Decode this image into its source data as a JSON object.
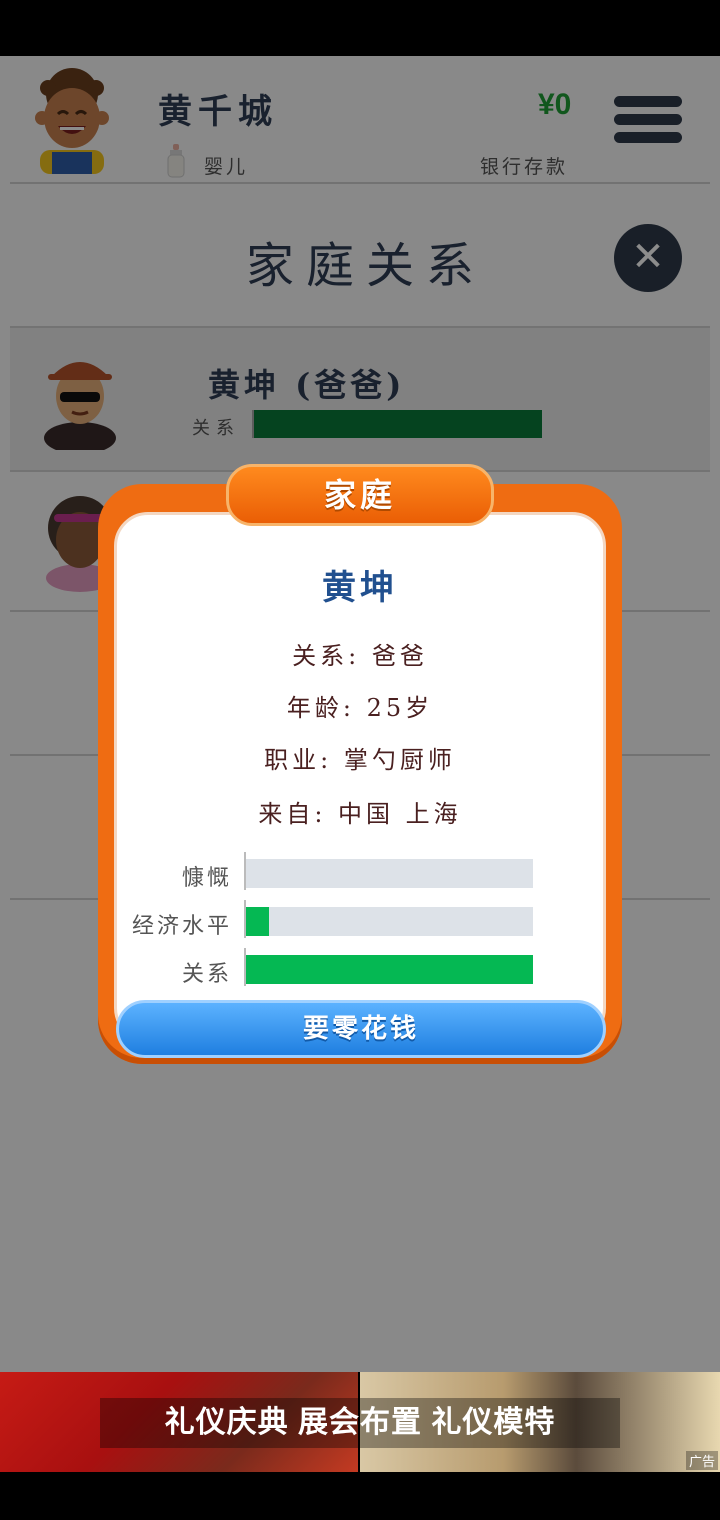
{
  "header": {
    "player_name": "黄千城",
    "life_stage": "婴儿",
    "money": "¥0",
    "money_label": "银行存款"
  },
  "page": {
    "title": "家庭关系"
  },
  "relatives": [
    {
      "name": "黄坤 (爸爸)",
      "relation_label": "关系",
      "relation_level": 1.0
    }
  ],
  "modal": {
    "tab_title": "家庭",
    "person_name": "黄坤",
    "relation_line": "关系: 爸爸",
    "age_line": "年龄: 25岁",
    "job_line": "职业: 掌勺厨师",
    "origin_line": "来自: 中国 上海",
    "stats": [
      {
        "label": "慷慨",
        "level": 0.0
      },
      {
        "label": "经济水平",
        "level": 0.08
      },
      {
        "label": "关系",
        "level": 1.0
      }
    ],
    "action_button": "要零花钱"
  },
  "ad": {
    "text": "礼仪庆典  展会布置  礼仪模特",
    "badge": "广告"
  },
  "colors": {
    "accent_orange": "#ef6c12",
    "bar_green": "#05b853",
    "dark_green_bar": "#0a7a3a",
    "navy": "#2f3a4a",
    "button_blue": "#1f7fe0"
  }
}
